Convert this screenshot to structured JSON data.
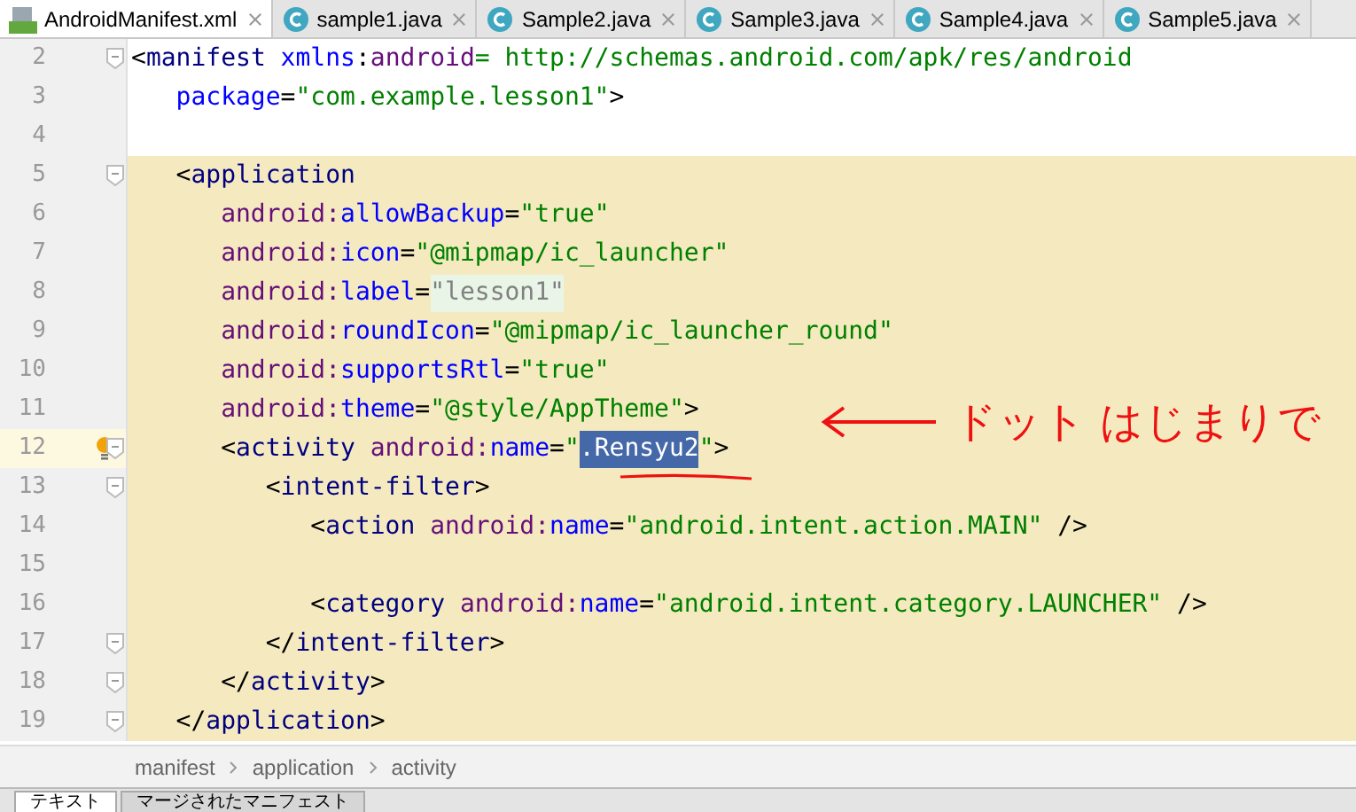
{
  "tabs": [
    {
      "label": "AndroidManifest.xml",
      "kind": "xml",
      "selected": true
    },
    {
      "label": "sample1.java",
      "kind": "java",
      "selected": false
    },
    {
      "label": "Sample2.java",
      "kind": "java",
      "selected": false
    },
    {
      "label": "Sample3.java",
      "kind": "java",
      "selected": false
    },
    {
      "label": "Sample4.java",
      "kind": "java",
      "selected": false
    },
    {
      "label": "Sample5.java",
      "kind": "java",
      "selected": false
    }
  ],
  "editor": {
    "lines": [
      {
        "number": "2",
        "fold": true,
        "highlighted": false,
        "current": false,
        "bulb": false,
        "tokens": [
          {
            "kind": "punct",
            "text": "<"
          },
          {
            "kind": "tag",
            "text": "manifest "
          },
          {
            "kind": "attr",
            "text": "xmlns"
          },
          {
            "kind": "punct",
            "text": ":"
          },
          {
            "kind": "ns",
            "text": "android"
          },
          {
            "kind": "value",
            "text": "= http://schemas.android.com/apk/res/android"
          }
        ]
      },
      {
        "number": "3",
        "fold": false,
        "highlighted": false,
        "current": false,
        "bulb": false,
        "tokens": [
          {
            "kind": "attr",
            "text": "   package"
          },
          {
            "kind": "punct",
            "text": "="
          },
          {
            "kind": "value",
            "text": "\"com.example.lesson1\""
          },
          {
            "kind": "punct",
            "text": ">"
          }
        ]
      },
      {
        "number": "4",
        "fold": false,
        "highlighted": false,
        "current": false,
        "bulb": false
      },
      {
        "number": "5",
        "fold": true,
        "highlighted": true,
        "current": false,
        "bulb": false,
        "tokens": [
          {
            "kind": "punct",
            "text": "   <"
          },
          {
            "kind": "tag",
            "text": "application"
          }
        ]
      },
      {
        "number": "6",
        "fold": false,
        "highlighted": true,
        "current": false,
        "bulb": false,
        "tokens": [
          {
            "kind": "ns",
            "text": "      android:"
          },
          {
            "kind": "attr",
            "text": "allowBackup"
          },
          {
            "kind": "punct",
            "text": "="
          },
          {
            "kind": "value",
            "text": "\"true\""
          }
        ]
      },
      {
        "number": "7",
        "fold": false,
        "highlighted": true,
        "current": false,
        "bulb": false,
        "tokens": [
          {
            "kind": "ns",
            "text": "      android:"
          },
          {
            "kind": "attr",
            "text": "icon"
          },
          {
            "kind": "punct",
            "text": "="
          },
          {
            "kind": "value",
            "text": "\"@mipmap/ic_launcher\""
          }
        ]
      },
      {
        "number": "8",
        "fold": false,
        "highlighted": true,
        "current": false,
        "bulb": false,
        "tokens": [
          {
            "kind": "ns",
            "text": "      android:"
          },
          {
            "kind": "attr",
            "text": "label"
          },
          {
            "kind": "punct",
            "text": "="
          },
          {
            "kind": "folded",
            "text": "\"lesson1\""
          }
        ]
      },
      {
        "number": "9",
        "fold": false,
        "highlighted": true,
        "current": false,
        "bulb": false,
        "tokens": [
          {
            "kind": "ns",
            "text": "      android:"
          },
          {
            "kind": "attr",
            "text": "roundIcon"
          },
          {
            "kind": "punct",
            "text": "="
          },
          {
            "kind": "value",
            "text": "\"@mipmap/ic_launcher_round\""
          }
        ]
      },
      {
        "number": "10",
        "fold": false,
        "highlighted": true,
        "current": false,
        "bulb": false,
        "tokens": [
          {
            "kind": "ns",
            "text": "      android:"
          },
          {
            "kind": "attr",
            "text": "supportsRtl"
          },
          {
            "kind": "punct",
            "text": "="
          },
          {
            "kind": "value",
            "text": "\"true\""
          }
        ]
      },
      {
        "number": "11",
        "fold": false,
        "highlighted": true,
        "current": false,
        "bulb": false,
        "tokens": [
          {
            "kind": "ns",
            "text": "      android:"
          },
          {
            "kind": "attr",
            "text": "theme"
          },
          {
            "kind": "punct",
            "text": "="
          },
          {
            "kind": "value",
            "text": "\"@style/AppTheme\""
          },
          {
            "kind": "punct",
            "text": ">"
          }
        ]
      },
      {
        "number": "12",
        "fold": true,
        "highlighted": true,
        "current": true,
        "bulb": true,
        "tokens": [
          {
            "kind": "punct",
            "text": "      <"
          },
          {
            "kind": "tag",
            "text": "activity "
          },
          {
            "kind": "ns",
            "text": "android:"
          },
          {
            "kind": "attr",
            "text": "name"
          },
          {
            "kind": "punct",
            "text": "="
          },
          {
            "kind": "value",
            "text": "\""
          },
          {
            "kind": "selected",
            "text": ".Rensyu2"
          },
          {
            "kind": "value",
            "text": "\""
          },
          {
            "kind": "punct",
            "text": ">"
          }
        ]
      },
      {
        "number": "13",
        "fold": true,
        "highlighted": true,
        "current": false,
        "bulb": false,
        "tokens": [
          {
            "kind": "punct",
            "text": "         <"
          },
          {
            "kind": "tag",
            "text": "intent-filter"
          },
          {
            "kind": "punct",
            "text": ">"
          }
        ]
      },
      {
        "number": "14",
        "fold": false,
        "highlighted": true,
        "current": false,
        "bulb": false,
        "tokens": [
          {
            "kind": "punct",
            "text": "            <"
          },
          {
            "kind": "tag",
            "text": "action "
          },
          {
            "kind": "ns",
            "text": "android:"
          },
          {
            "kind": "attr",
            "text": "name"
          },
          {
            "kind": "punct",
            "text": "="
          },
          {
            "kind": "value",
            "text": "\"android.intent.action.MAIN\""
          },
          {
            "kind": "punct",
            "text": " />"
          }
        ]
      },
      {
        "number": "15",
        "fold": false,
        "highlighted": true,
        "current": false,
        "bulb": false
      },
      {
        "number": "16",
        "fold": false,
        "highlighted": true,
        "current": false,
        "bulb": false,
        "tokens": [
          {
            "kind": "punct",
            "text": "            <"
          },
          {
            "kind": "tag",
            "text": "category "
          },
          {
            "kind": "ns",
            "text": "android:"
          },
          {
            "kind": "attr",
            "text": "name"
          },
          {
            "kind": "punct",
            "text": "="
          },
          {
            "kind": "value",
            "text": "\"android.intent.category.LAUNCHER\""
          },
          {
            "kind": "punct",
            "text": " />"
          }
        ]
      },
      {
        "number": "17",
        "fold": true,
        "highlighted": true,
        "current": false,
        "bulb": false,
        "tokens": [
          {
            "kind": "punct",
            "text": "         </"
          },
          {
            "kind": "tag",
            "text": "intent-filter"
          },
          {
            "kind": "punct",
            "text": ">"
          }
        ]
      },
      {
        "number": "18",
        "fold": true,
        "highlighted": true,
        "current": false,
        "bulb": false,
        "tokens": [
          {
            "kind": "punct",
            "text": "      </"
          },
          {
            "kind": "tag",
            "text": "activity"
          },
          {
            "kind": "punct",
            "text": ">"
          }
        ]
      },
      {
        "number": "19",
        "fold": true,
        "highlighted": true,
        "current": false,
        "bulb": false,
        "tokens": [
          {
            "kind": "punct",
            "text": "   </"
          },
          {
            "kind": "tag",
            "text": "application"
          },
          {
            "kind": "punct",
            "text": ">"
          }
        ]
      }
    ]
  },
  "annotation": {
    "text": "ドット はじまりで"
  },
  "breadcrumb": [
    "manifest",
    "application",
    "activity"
  ],
  "bottom_tabs": [
    {
      "label": "テキスト",
      "selected": true
    },
    {
      "label": "マージされたマニフェスト",
      "selected": false
    }
  ]
}
